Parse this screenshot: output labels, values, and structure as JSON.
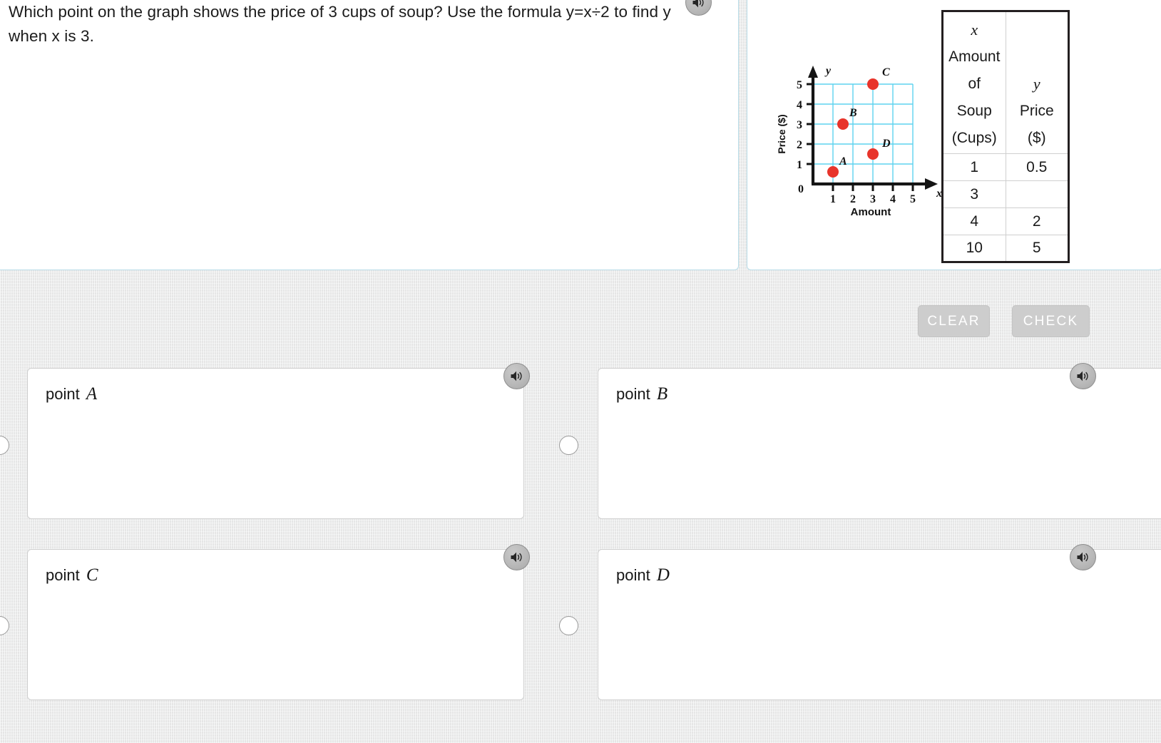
{
  "question": {
    "text": "Which point on the graph shows the price of 3 cups of soup? Use the formula y=x÷2 to find y when x is 3.",
    "speaker_icon": "speaker-icon"
  },
  "figure": {
    "graph": {
      "y_axis_label": "Price ($)",
      "x_axis_label": "Amount",
      "x_axis_symbol": "x",
      "y_axis_symbol": "y",
      "origin_label": "0",
      "x_ticks": [
        "1",
        "2",
        "3",
        "4",
        "5"
      ],
      "y_ticks": [
        "1",
        "2",
        "3",
        "4",
        "5"
      ],
      "point_labels": [
        "A",
        "B",
        "C",
        "D"
      ],
      "grid_color": "#4fd0f0",
      "point_color": "#e8342b"
    },
    "table": {
      "header_x_symbol": "x",
      "header_x_line1": "Amount",
      "header_x_line2": "of",
      "header_x_line3": "Soup",
      "header_x_line4": "(Cups)",
      "header_y_symbol": "y",
      "header_y_line1": "Price",
      "header_y_line2": "($)",
      "rows": [
        {
          "x": "1",
          "y": "0.5"
        },
        {
          "x": "3",
          "y": ""
        },
        {
          "x": "4",
          "y": "2"
        },
        {
          "x": "10",
          "y": "5"
        }
      ]
    }
  },
  "chart_data": {
    "type": "scatter",
    "title": "",
    "xlabel": "Amount",
    "ylabel": "Price ($)",
    "xlim": [
      0,
      5.5
    ],
    "ylim": [
      0,
      5.5
    ],
    "grid": true,
    "xticks": [
      1,
      2,
      3,
      4,
      5
    ],
    "yticks": [
      1,
      2,
      3,
      4,
      5
    ],
    "series": [
      {
        "name": "points",
        "points": [
          {
            "label": "A",
            "x": 1,
            "y": 0.6
          },
          {
            "label": "B",
            "x": 1.5,
            "y": 3
          },
          {
            "label": "C",
            "x": 3,
            "y": 5
          },
          {
            "label": "D",
            "x": 3,
            "y": 1.5
          }
        ]
      }
    ],
    "table": {
      "columns": [
        "x Amount of Soup (Cups)",
        "y Price ($)"
      ],
      "rows": [
        [
          "1",
          "0.5"
        ],
        [
          "3",
          ""
        ],
        [
          "4",
          "2"
        ],
        [
          "10",
          "5"
        ]
      ]
    }
  },
  "toolbar": {
    "clear_label": "CLEAR",
    "check_label": "CHECK"
  },
  "choices": [
    {
      "prefix": "point ",
      "letter": "A",
      "speaker_icon": "speaker-icon"
    },
    {
      "prefix": "point ",
      "letter": "B",
      "speaker_icon": "speaker-icon"
    },
    {
      "prefix": "point ",
      "letter": "C",
      "speaker_icon": "speaker-icon"
    },
    {
      "prefix": "point ",
      "letter": "D",
      "speaker_icon": "speaker-icon"
    }
  ],
  "colors": {
    "panel_border": "#b8dce8",
    "page_background": "#ebecec",
    "button_face": "#cdcdcd",
    "button_text": "#ffffff"
  }
}
